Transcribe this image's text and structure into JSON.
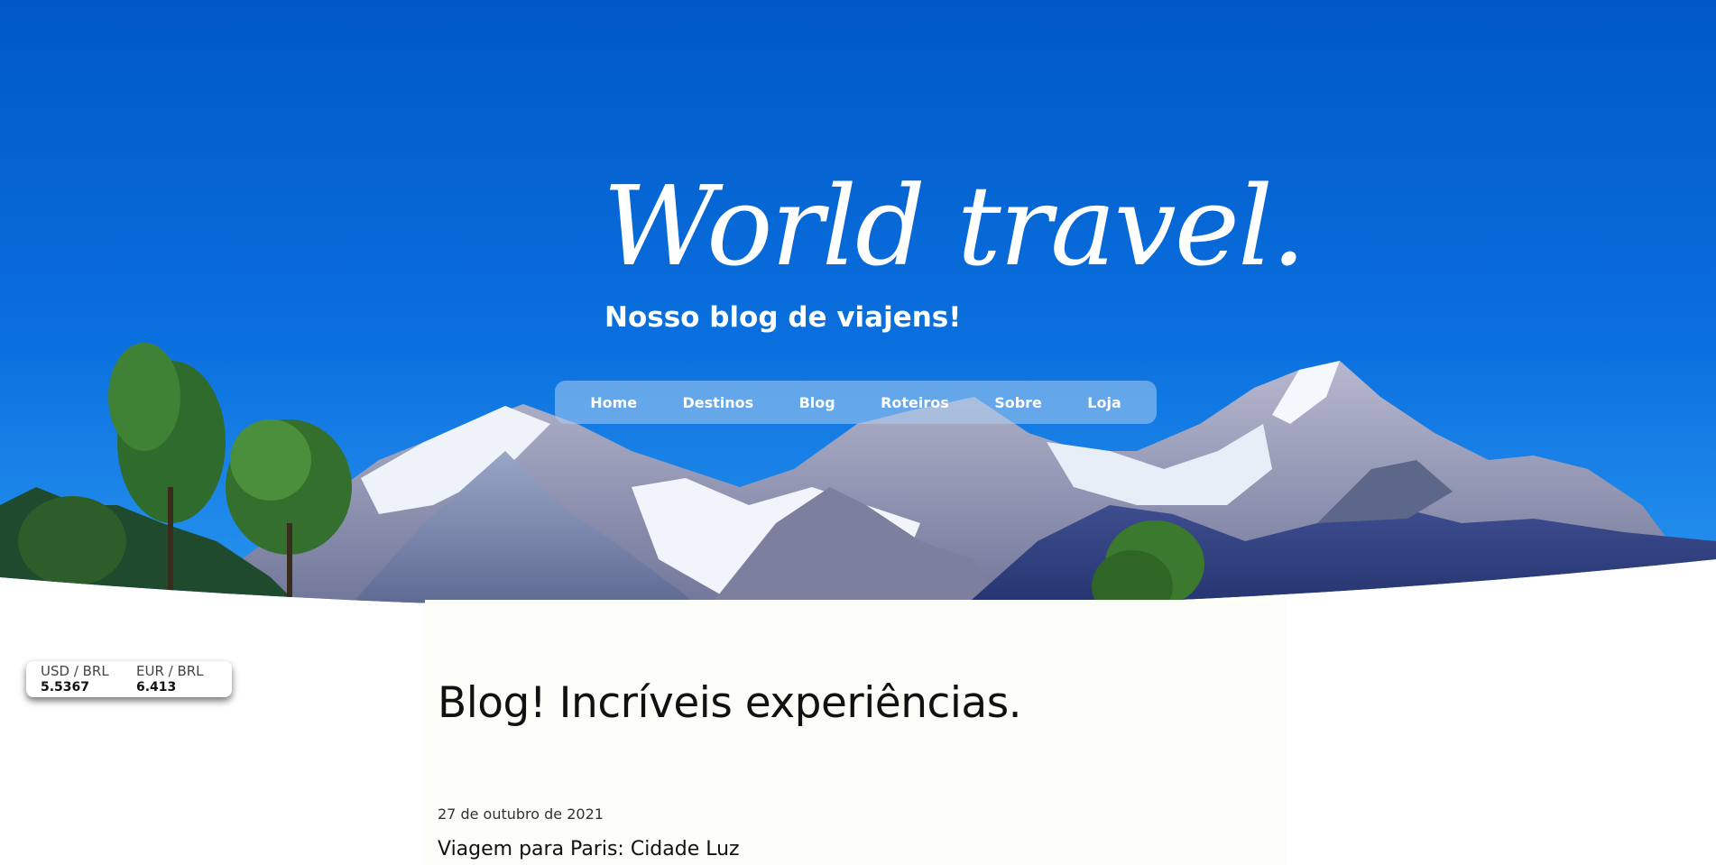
{
  "hero": {
    "title": "World travel.",
    "subtitle": "Nosso blog de viajens!",
    "sky_color_top": "#0058c6",
    "sky_color_bottom": "#1f8ff0"
  },
  "nav": {
    "items": [
      {
        "label": "Home"
      },
      {
        "label": "Destinos"
      },
      {
        "label": "Blog"
      },
      {
        "label": "Roteiros"
      },
      {
        "label": "Sobre"
      },
      {
        "label": "Loja"
      }
    ]
  },
  "currency": {
    "usd": {
      "pair": "USD / BRL",
      "value": "5.5367"
    },
    "eur": {
      "pair": "EUR / BRL",
      "value": "6.413"
    }
  },
  "blog": {
    "heading": "Blog! Incríveis experiências.",
    "posts": [
      {
        "date": "27 de outubro de 2021",
        "title": "Viagem para Paris: Cidade Luz"
      }
    ]
  }
}
